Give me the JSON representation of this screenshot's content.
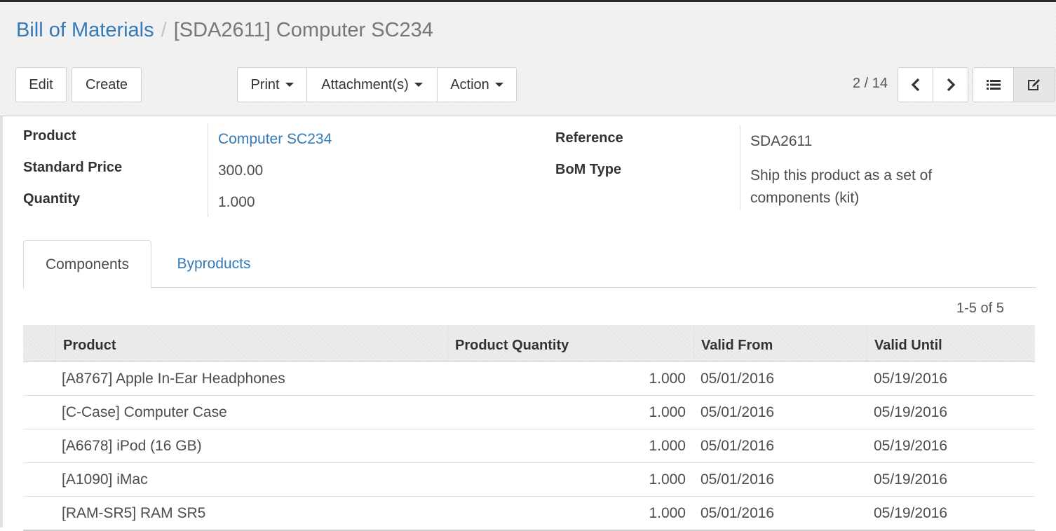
{
  "breadcrumb": {
    "parent": "Bill of Materials",
    "separator": "/",
    "current": "[SDA2611] Computer SC234"
  },
  "toolbar": {
    "edit_label": "Edit",
    "create_label": "Create",
    "print_label": "Print",
    "attachments_label": "Attachment(s)",
    "action_label": "Action"
  },
  "pager": {
    "value": "2 / 14"
  },
  "form": {
    "product_label": "Product",
    "product_value": "Computer SC234",
    "standard_price_label": "Standard Price",
    "standard_price_value": "300.00",
    "quantity_label": "Quantity",
    "quantity_value": "1.000",
    "reference_label": "Reference",
    "reference_value": "SDA2611",
    "bom_type_label": "BoM Type",
    "bom_type_value": "Ship this product as a set of components (kit)"
  },
  "tabs": [
    {
      "label": "Components",
      "active": true
    },
    {
      "label": "Byproducts",
      "active": false
    }
  ],
  "list": {
    "pager": "1-5 of 5",
    "columns": [
      "Product",
      "Product Quantity",
      "Valid From",
      "Valid Until"
    ],
    "rows": [
      {
        "product": "[A8767] Apple In-Ear Headphones",
        "quantity": "1.000",
        "valid_from": "05/01/2016",
        "valid_until": "05/19/2016"
      },
      {
        "product": "[C-Case] Computer Case",
        "quantity": "1.000",
        "valid_from": "05/01/2016",
        "valid_until": "05/19/2016"
      },
      {
        "product": "[A6678] iPod (16 GB)",
        "quantity": "1.000",
        "valid_from": "05/01/2016",
        "valid_until": "05/19/2016"
      },
      {
        "product": "[A1090] iMac",
        "quantity": "1.000",
        "valid_from": "05/01/2016",
        "valid_until": "05/19/2016"
      },
      {
        "product": "[RAM-SR5] RAM SR5",
        "quantity": "1.000",
        "valid_from": "05/01/2016",
        "valid_until": "05/19/2016"
      }
    ]
  },
  "icons": {
    "prev": "chevron-left-icon",
    "next": "chevron-right-icon",
    "list_view": "list-view-icon",
    "form_view": "edit-form-icon"
  },
  "colors": {
    "link": "#337ab7",
    "text": "#4c4c4c"
  }
}
